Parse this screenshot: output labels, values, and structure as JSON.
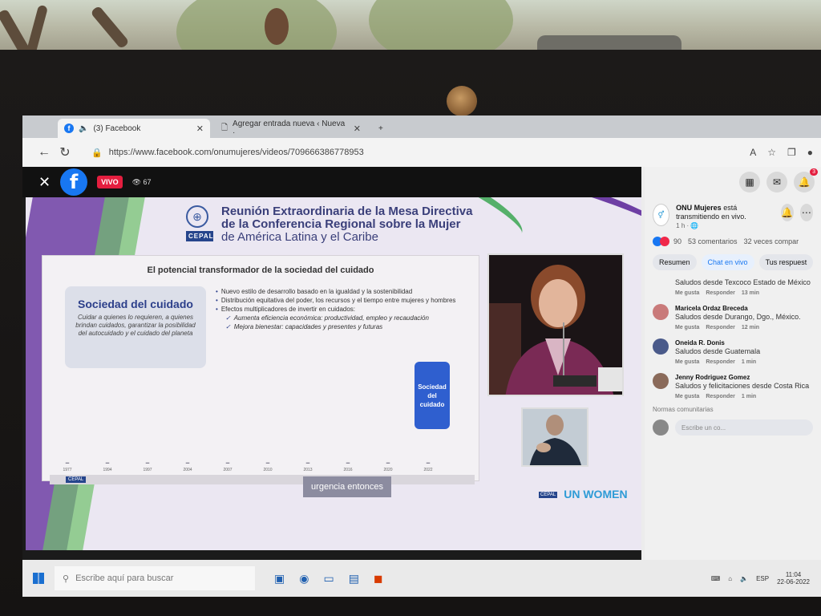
{
  "browser": {
    "tabs": [
      {
        "label": "(3) Facebook",
        "active": true
      },
      {
        "label": "Agregar entrada nueva ‹ Nueva ·",
        "active": false
      }
    ],
    "url": "https://www.facebook.com/onumujeres/videos/709666386778953"
  },
  "video": {
    "live_label": "VIVO",
    "viewers": "67"
  },
  "slide": {
    "org_label": "CEPAL",
    "title_line1": "Reunión Extraordinaria de la Mesa Directiva",
    "title_line2": "de la Conferencia Regional sobre la Mujer",
    "title_line3": "de América Latina y el Caribe",
    "section_title": "El potencial transformador de la sociedad del cuidado",
    "box_title": "Sociedad del cuidado",
    "box_desc": "Cuidar a quienes lo requieren, a quienes brindan cuidados, garantizar la posibilidad del autocuidado y el cuidado del planeta",
    "bullets": [
      "Nuevo estilo de desarrollo basado en la igualdad y la sostenibilidad",
      "Distribución equitativa del poder, los recursos y el tiempo entre mujeres y hombres",
      "Efectos multiplicadores de invertir en cuidados:"
    ],
    "checks": [
      "Aumenta eficiencia económica: productividad, empleo y recaudación",
      "Mejora bienestar: capacidades y presentes y futuras"
    ],
    "timeline_years": [
      "1977",
      "1994",
      "1997",
      "2004",
      "2007",
      "2010",
      "2013",
      "2016",
      "2020",
      "2022"
    ],
    "timeline_final": "Sociedad del cuidado",
    "caption": "urgencia entonces",
    "unwomen": "UN WOMEN"
  },
  "sidebar": {
    "notif_count": "3",
    "page_name": "ONU Mujeres",
    "page_status": "está transmitiendo en vivo.",
    "page_time": "1 h · ",
    "reactions": "90",
    "comments": "53 comentarios",
    "shares": "32 veces compar",
    "tabs": [
      "Resumen",
      "Chat en vivo",
      "Tus respuest"
    ],
    "comments_list": [
      {
        "name": "",
        "text": "Saludos desde Texcoco Estado de México",
        "like": "Me gusta",
        "reply": "Responder",
        "time": "13 min"
      },
      {
        "name": "Maricela Ordaz Breceda",
        "text": "Saludos desde Durango, Dgo., México.",
        "like": "Me gusta",
        "reply": "Responder",
        "time": "12 min"
      },
      {
        "name": "Oneida R. Donis",
        "text": "Saludos desde Guatemala",
        "like": "Me gusta",
        "reply": "Responder",
        "time": "1 min"
      },
      {
        "name": "Jenny Rodriguez Gomez",
        "text": "Saludos y felicitaciones desde Costa Rica",
        "like": "Me gusta",
        "reply": "Responder",
        "time": "1 min"
      }
    ],
    "norms": "Normas comunitarias",
    "write_placeholder": "Escribe un co..."
  },
  "taskbar": {
    "search_placeholder": "Escribe aquí para buscar",
    "lang": "ESP",
    "time": "11:04",
    "date": "22-06-2022"
  }
}
